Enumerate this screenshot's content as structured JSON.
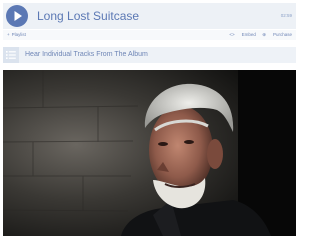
{
  "player": {
    "title": "Long Lost Suitcase",
    "time": "02:59",
    "play_icon": "play-icon"
  },
  "meta": {
    "playlist_label": "Playlist",
    "embed_label": "Embed",
    "purchase_label": "Purchase"
  },
  "tracks": {
    "label": "Hear Individual Tracks From The Album",
    "icon": "list-icon"
  },
  "colors": {
    "accent": "#5b78b4",
    "bar_bg": "#edf1f6"
  }
}
